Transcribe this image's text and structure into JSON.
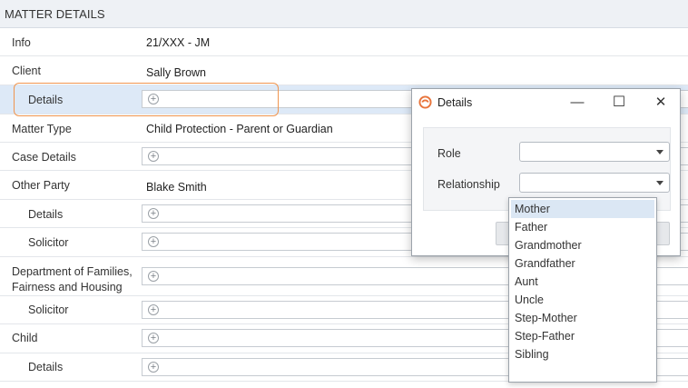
{
  "header": {
    "title": "MATTER DETAILS"
  },
  "rows": [
    {
      "label": "Info",
      "value": "21/XXX - JM"
    },
    {
      "label": "Client",
      "value": "Sally Brown"
    },
    {
      "label": "Details"
    },
    {
      "label": "Matter Type",
      "value": "Child Protection - Parent or Guardian"
    },
    {
      "label": "Case Details"
    },
    {
      "label": "Other Party",
      "value": "Blake Smith"
    },
    {
      "label": "Details"
    },
    {
      "label": "Solicitor"
    },
    {
      "label_line1": "Department of Families,",
      "label_line2": "Fairness and Housing"
    },
    {
      "label": "Solicitor"
    },
    {
      "label": "Child"
    },
    {
      "label": "Details"
    }
  ],
  "add_icon": "plus-circle-icon",
  "dialog": {
    "title": "Details",
    "logo_icon": "app-logo-icon",
    "role_label": "Role",
    "role_value": "",
    "relationship_label": "Relationship",
    "relationship_value": "",
    "minimize_glyph": "—",
    "maximize_glyph": "☐",
    "close_glyph": "✕"
  },
  "dropdown": {
    "selected_index": 0,
    "options": [
      "Mother",
      "Father",
      "Grandmother",
      "Grandfather",
      "Aunt",
      "Uncle",
      "Step-Mother",
      "Step-Father",
      "Sibling"
    ]
  },
  "colors": {
    "accent_orange": "#f0954f",
    "highlight_row": "#dde9f7",
    "selected_option": "#dbe7f4"
  }
}
